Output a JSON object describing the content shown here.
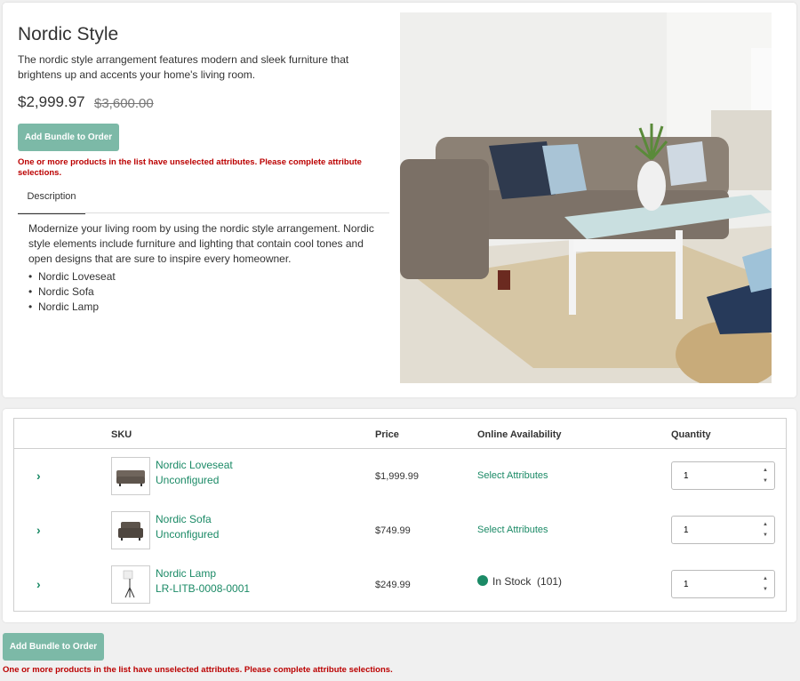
{
  "bundle": {
    "title": "Nordic Style",
    "description": "The nordic style arrangement features modern and sleek furniture that brightens up and accents your home's living room.",
    "price": "$2,999.97",
    "old_price": "$3,600.00",
    "add_label": "Add Bundle to Order",
    "error": "One or more products in the list have unselected attributes. Please complete attribute selections."
  },
  "tabs": {
    "description_label": "Description",
    "body": "Modernize your living room by using the nordic style arrangement. Nordic style elements include furniture and lighting that contain cool tones and open designs that are sure to inspire every homeowner.",
    "items": [
      "Nordic Loveseat",
      "Nordic Sofa",
      "Nordic Lamp"
    ]
  },
  "table": {
    "headers": {
      "sku": "SKU",
      "price": "Price",
      "availability": "Online Availability",
      "quantity": "Quantity"
    },
    "rows": [
      {
        "name": "Nordic Loveseat",
        "sku": "Unconfigured",
        "price": "$1,999.99",
        "availability": "Select Attributes",
        "quantity": "1"
      },
      {
        "name": "Nordic Sofa",
        "sku": "Unconfigured",
        "price": "$749.99",
        "availability": "Select Attributes",
        "quantity": "1"
      },
      {
        "name": "Nordic Lamp",
        "sku": "LR-LITB-0008-0001",
        "price": "$249.99",
        "availability": "In Stock",
        "stock_count": "(101)",
        "quantity": "1"
      }
    ]
  },
  "footer": {
    "add_label": "Add Bundle to Order",
    "error": "One or more products in the list have unselected attributes. Please complete attribute selections."
  },
  "colors": {
    "accent": "#1b8a66",
    "button": "#7cb9a7",
    "error": "#bb0000"
  }
}
